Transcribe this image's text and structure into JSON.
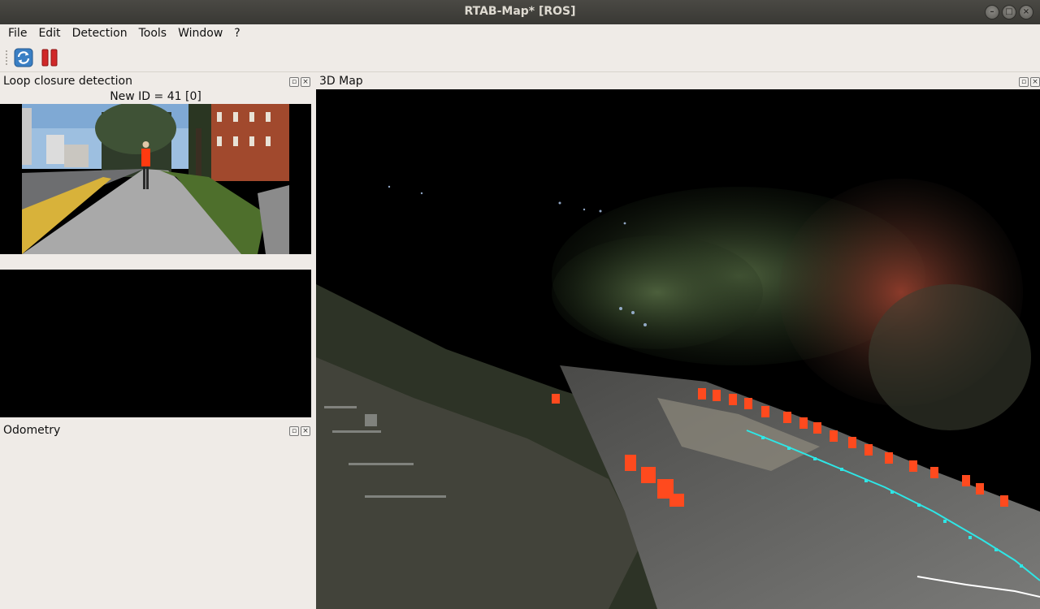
{
  "window": {
    "title": "RTAB-Map* [ROS]"
  },
  "menu": {
    "items": [
      "File",
      "Edit",
      "Detection",
      "Tools",
      "Window",
      "?"
    ]
  },
  "toolbar": {
    "refresh_icon": "refresh-icon",
    "pause_icon": "pause-icon",
    "accent_blue": "#3a7fc4",
    "accent_red": "#d02828"
  },
  "loop_dock": {
    "title": "Loop closure detection",
    "new_id_label": "New ID = 41 [0]"
  },
  "odometry_dock": {
    "title": "Odometry"
  },
  "map_dock": {
    "title": "3D Map",
    "trajectory_color": "#2ee6e6"
  }
}
